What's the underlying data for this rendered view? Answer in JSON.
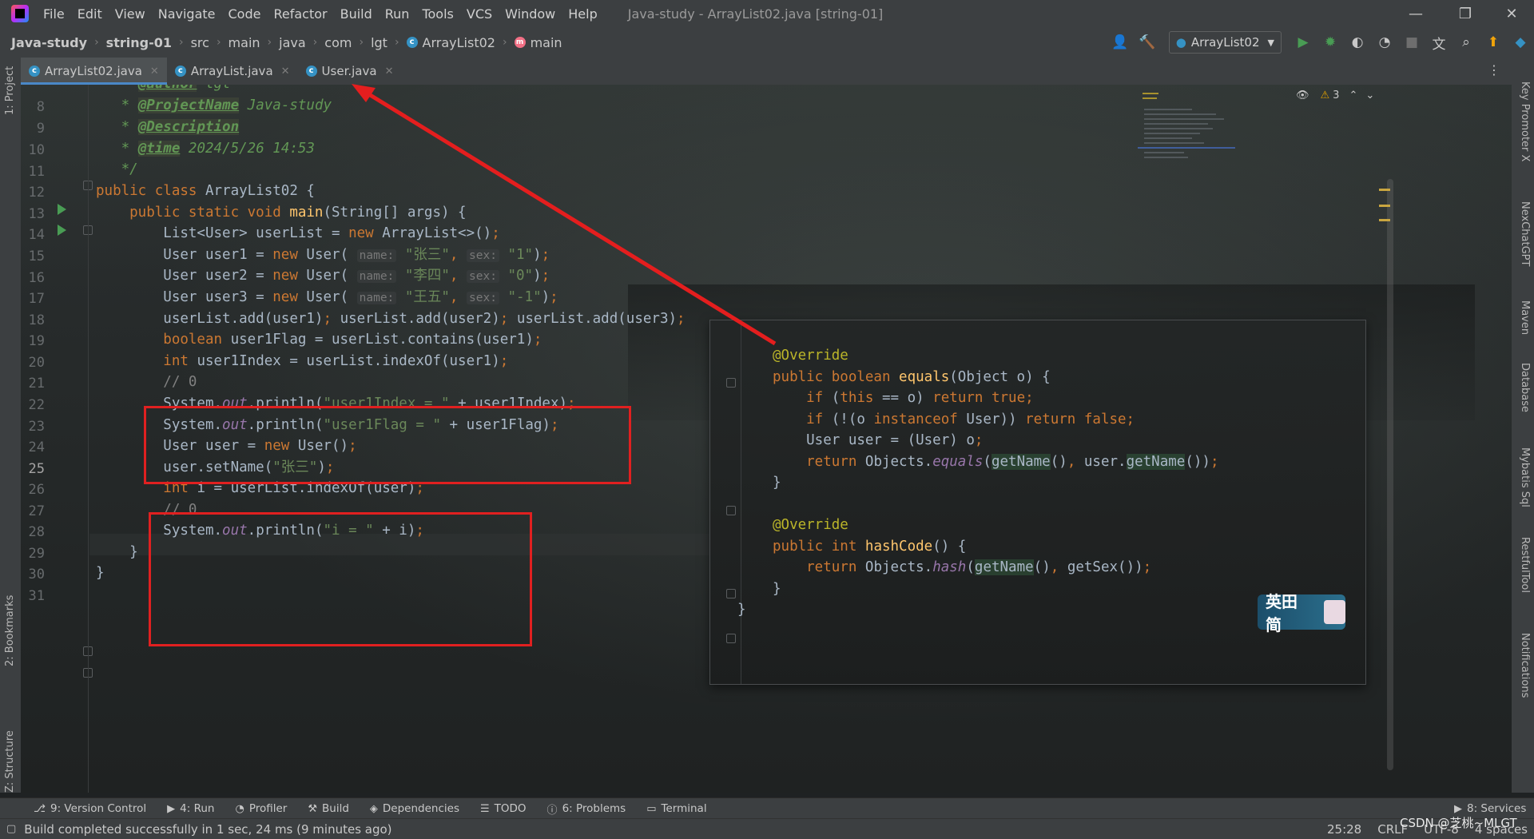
{
  "menubar": {
    "items": [
      "File",
      "Edit",
      "View",
      "Navigate",
      "Code",
      "Refactor",
      "Build",
      "Run",
      "Tools",
      "VCS",
      "Window",
      "Help"
    ],
    "window_title": "Java-study - ArrayList02.java [string-01]"
  },
  "breadcrumb": {
    "items": [
      "Java-study",
      "string-01",
      "src",
      "main",
      "java",
      "com",
      "lgt",
      "ArrayList02",
      "main"
    ]
  },
  "toolbar": {
    "run_config": "ArrayList02"
  },
  "tabs": [
    {
      "label": "ArrayList02.java",
      "active": true
    },
    {
      "label": "ArrayList.java",
      "active": false
    },
    {
      "label": "User.java",
      "active": false
    }
  ],
  "left_strip": {
    "project": "1: Project",
    "bookmarks": "2: Bookmarks",
    "structure": "Z: Structure"
  },
  "right_strip": {
    "key_promoter": "Key Promoter X",
    "nexchatgpt": "NexChatGPT",
    "maven": "Maven",
    "database": "Database",
    "mybatis": "Mybatis Sql",
    "restful": "RestfulTool",
    "notifications": "Notifications"
  },
  "editor": {
    "inspection_count": "3",
    "line_numbers": [
      "8",
      "9",
      "10",
      "11",
      "12",
      "13",
      "14",
      "15",
      "16",
      "17",
      "18",
      "19",
      "20",
      "21",
      "22",
      "23",
      "24",
      "25",
      "26",
      "27",
      "28",
      "29",
      "30",
      "31"
    ],
    "current_line": "25",
    "doc": {
      "author_tag": "@author",
      "author_value": "lgt",
      "project_tag": "@ProjectName",
      "project_value": "Java-study",
      "desc_tag": "@Description",
      "time_tag": "@time",
      "time_value": "2024/5/26 14:53"
    },
    "hints": {
      "name": "name:",
      "sex": "sex:"
    },
    "strings": {
      "u1name": "\"张三\"",
      "u1sex": "\"1\"",
      "u2name": "\"李四\"",
      "u2sex": "\"0\"",
      "u3name": "\"王五\"",
      "u3sex": "\"-1\"",
      "idx_msg": "\"user1Index = \"",
      "flag_msg": "\"user1Flag = \"",
      "setname": "\"张三\"",
      "i_msg": "\"i = \""
    },
    "comments": {
      "c1": "// 0",
      "c2": "// 0"
    }
  },
  "popup": {
    "override1": "@Override",
    "override2": "@Override"
  },
  "ime": {
    "label": "英田 简"
  },
  "bottom_tools": [
    "9: Version Control",
    "4: Run",
    "Profiler",
    "Build",
    "Dependencies",
    "TODO",
    "6: Problems",
    "Terminal"
  ],
  "services": "8: Services",
  "status": {
    "message": "Build completed successfully in 1 sec, 24 ms (9 minutes ago)",
    "position": "25:28",
    "line_sep": "CRLF",
    "encoding": "UTF-8",
    "indent": "4 spaces",
    "watermark": "CSDN @芝桃~MLGT"
  }
}
